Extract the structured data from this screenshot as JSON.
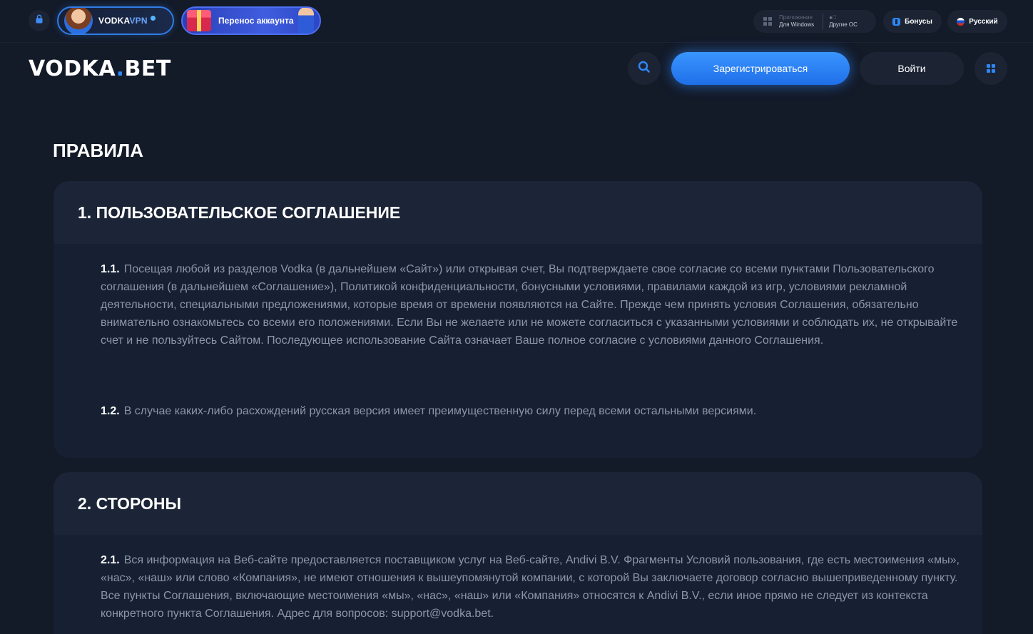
{
  "topbar": {
    "vpn_promo": {
      "brand": "VODKA",
      "accent": "VPN"
    },
    "transfer_promo": {
      "label": "Перенос аккаунта"
    },
    "app": {
      "caption": "Приложение",
      "windows_label": "Для Windows",
      "other_label": "Другие ОС"
    },
    "bonus_label": "Бонусы",
    "language_label": "Русский"
  },
  "header": {
    "logo_main": "VODKA",
    "logo_dot": ".",
    "logo_tail": "BET",
    "register_label": "Зарегистрироваться",
    "login_label": "Войти"
  },
  "page": {
    "title": "ПРАВИЛА",
    "sections": [
      {
        "heading": "1. ПОЛЬЗОВАТЕЛЬСКОЕ СОГЛАШЕНИЕ",
        "clauses": [
          {
            "num": "1.1.",
            "text": "Посещая любой из разделов Vodka (в дальнейшем «Сайт») или открывая счет, Вы подтверждаете свое согласие со всеми пунктами Пользовательского соглашения (в дальнейшем «Соглашение»), Политикой конфиденциальности, бонусными условиями, правилами каждой из игр, условиями рекламной деятельности, специальными предложениями, которые время от времени появляются на Сайте. Прежде чем принять условия Соглашения, обязательно внимательно ознакомьтесь со всеми его положениями. Если Вы не желаете или не можете согласиться с указанными условиями и соблюдать их, не открывайте счет и не пользуйтесь Сайтом. Последующее использование Сайта означает Ваше полное согласие с условиями данного Соглашения."
          },
          {
            "num": "1.2.",
            "text": "В случае каких-либо расхождений русская версия имеет преимущественную силу перед всеми остальными версиями."
          }
        ]
      },
      {
        "heading": "2. СТОРОНЫ",
        "clauses": [
          {
            "num": "2.1.",
            "text": "Вся информация на Веб-сайте предоставляется поставщиком услуг на Веб-сайте, Andivi B.V. Фрагменты Условий пользования, где есть местоимения «мы», «нас», «наш» или слово «Компания», не имеют отношения к вышеупомянутой компании, с которой Вы заключаете договор согласно вышеприведенному пункту. Все пункты Соглашения, включающие местоимения «мы», «нас», «наш» или «Компания» относятся к Andivi B.V., если иное прямо не следует из контекста конкретного пункта Соглашения. Адрес для вопросов: support@vodka.bet."
          }
        ]
      }
    ]
  },
  "icons": {
    "lock": "lock-icon",
    "search": "search-icon",
    "grid": "grid-icon",
    "windows": "windows-icon",
    "bonus": "bonus-icon",
    "flag": "flag-ru-icon"
  },
  "colors": {
    "background": "#131a28",
    "card": "#172032",
    "card_header": "#1c2537",
    "accent": "#2f86f6",
    "body_text": "#8d96a6"
  }
}
